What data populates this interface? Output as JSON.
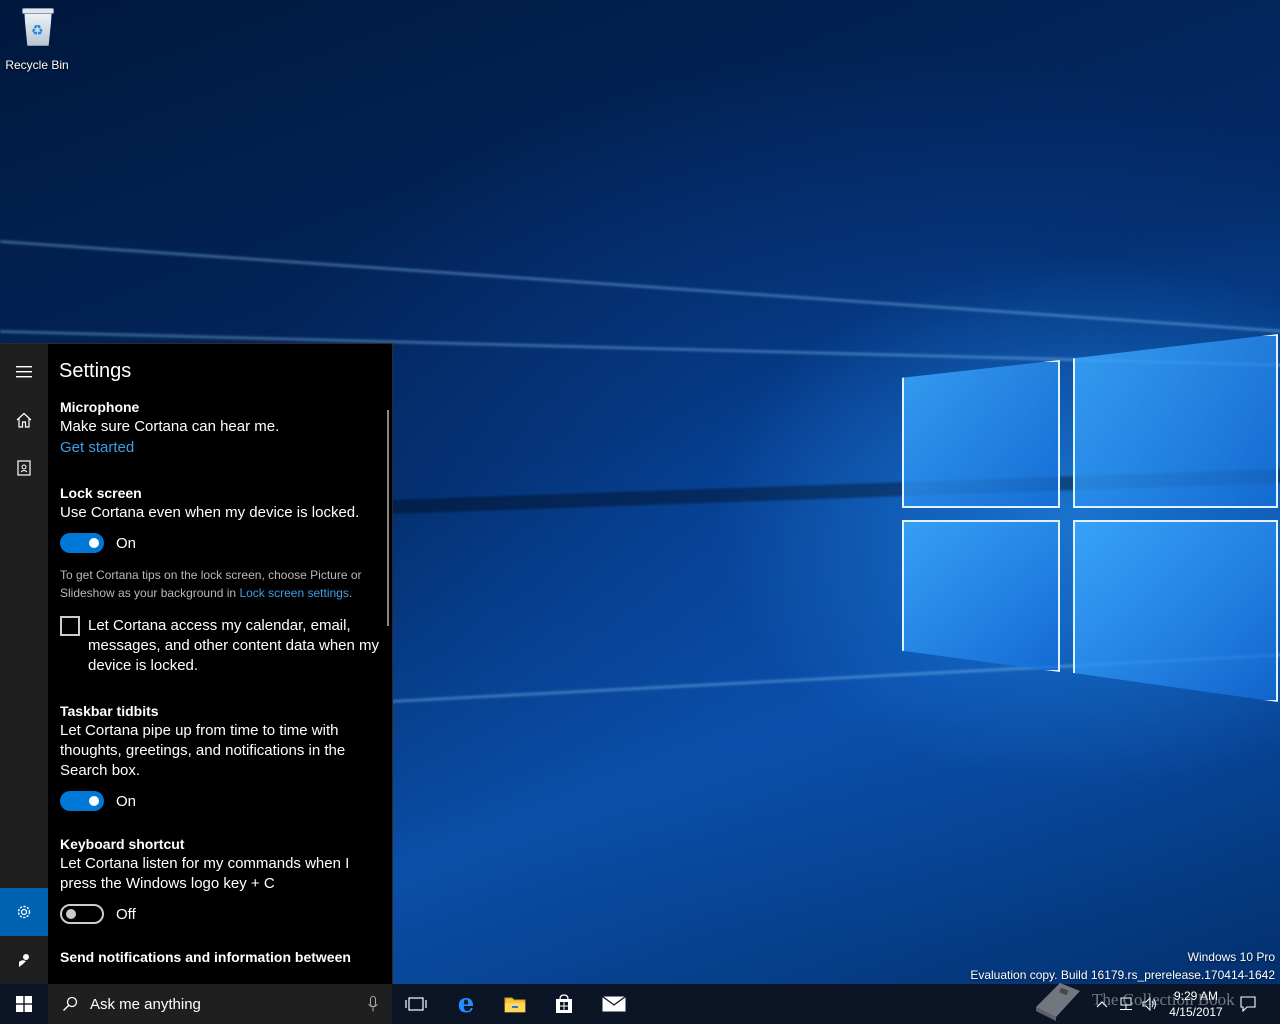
{
  "desktop": {
    "icons": [
      {
        "label": "Recycle Bin",
        "icon": "recycle-bin-icon"
      }
    ],
    "watermark": {
      "edition": "Windows 10 Pro",
      "build": "Evaluation copy. Build 16179.rs_prerelease.170414-1642"
    }
  },
  "cortana": {
    "rail": {
      "icons": [
        "hamburger-menu-icon",
        "home-icon",
        "notebook-icon"
      ],
      "bottom_icons": [
        "gear-icon",
        "feedback-icon"
      ]
    },
    "title": "Settings",
    "sections": {
      "microphone": {
        "title": "Microphone",
        "description": "Make sure Cortana can hear me.",
        "link": "Get started"
      },
      "lock_screen": {
        "title": "Lock screen",
        "description": "Use Cortana even when my device is locked.",
        "toggle_state": "On",
        "note_before": "To get Cortana tips on the lock screen, choose Picture or Slideshow as your background in ",
        "note_link": "Lock screen settings",
        "note_after": ".",
        "checkbox_label": "Let Cortana access my calendar, email, messages, and other content data when my device is locked."
      },
      "taskbar_tidbits": {
        "title": "Taskbar tidbits",
        "description": "Let Cortana pipe up from time to time with thoughts, greetings, and notifications in the Search box.",
        "toggle_state": "On"
      },
      "keyboard_shortcut": {
        "title": "Keyboard shortcut",
        "description": "Let Cortana listen for my commands when I press the Windows logo key + C",
        "toggle_state": "Off"
      },
      "send_notifications": {
        "title": "Send notifications and information between"
      }
    }
  },
  "taskbar": {
    "search_placeholder": "Ask me anything",
    "pinned_icons": [
      "task-view-icon",
      "edge-icon",
      "file-explorer-icon",
      "store-icon",
      "mail-icon"
    ],
    "tray_icons": [
      "chevron-up-icon",
      "network-icon",
      "volume-icon",
      "action-center-icon"
    ],
    "time": "9:29 AM",
    "date": "4/15/2017"
  },
  "overlay_logo": "The Collection Book",
  "colors": {
    "accent": "#0078d7",
    "link": "#3c9fe8",
    "rail_active": "#0063b1"
  }
}
